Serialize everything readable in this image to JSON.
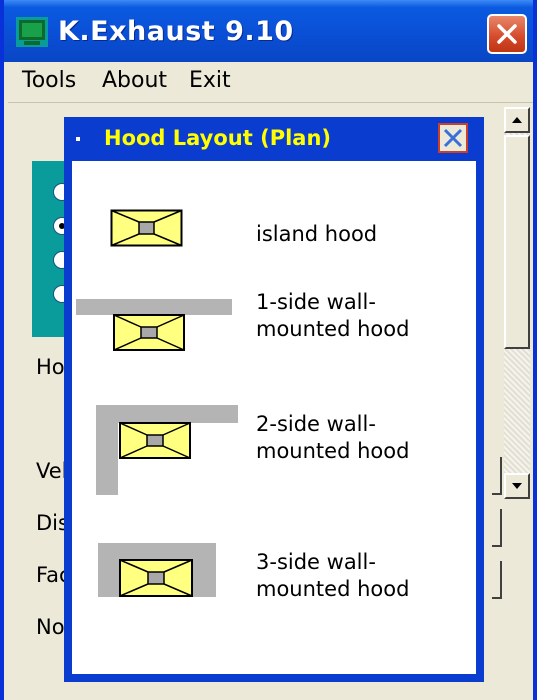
{
  "window": {
    "title": "K.Exhaust 9.10"
  },
  "menu": {
    "items": [
      "Tools",
      "About",
      "Exit"
    ]
  },
  "background_labels": [
    "Ho",
    "Vel",
    "Dis",
    "Fac",
    "No"
  ],
  "dialog": {
    "title": "Hood Layout (Plan)",
    "options": [
      {
        "lines": [
          "island hood"
        ]
      },
      {
        "lines": [
          "1-side wall-",
          "mounted hood"
        ]
      },
      {
        "lines": [
          "2-side wall-",
          "mounted hood"
        ]
      },
      {
        "lines": [
          "3-side wall-",
          "mounted hood"
        ]
      }
    ]
  },
  "colors": {
    "hood_fill": "#ffff80",
    "hood_stroke": "#000000",
    "center": "#a8a8a8",
    "wall": "#b4b4b4",
    "dialog_title": "#ffff00"
  },
  "icons": {
    "app": "app-icon",
    "close": "close-icon",
    "dialog_close": "close-icon"
  }
}
